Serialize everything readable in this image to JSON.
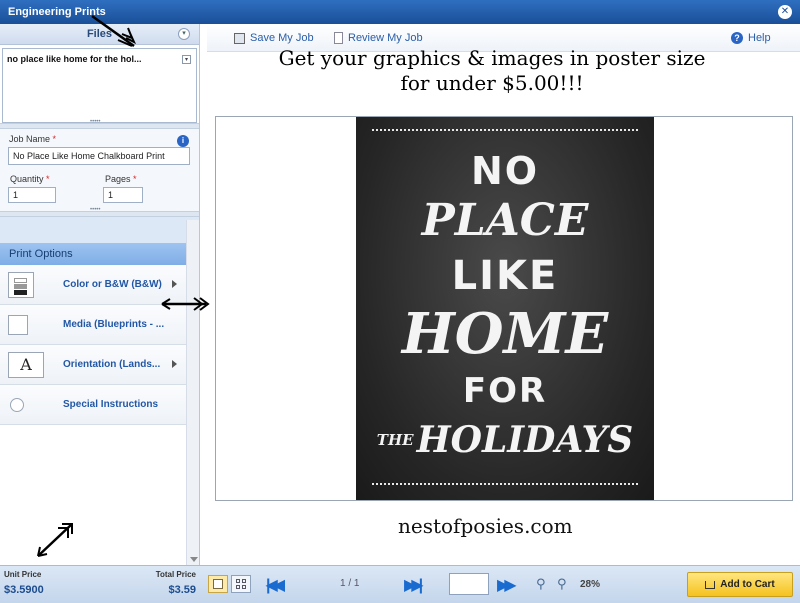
{
  "window": {
    "title": "Engineering Prints",
    "close_glyph": "✕"
  },
  "files": {
    "header": "Files",
    "selected_file": "no place like home for the hol...",
    "dropdown_glyph": "▾"
  },
  "job": {
    "name_label": "Job Name",
    "required_mark": "*",
    "name_value": "No Place Like Home Chalkboard Print",
    "quantity_label": "Quantity",
    "quantity_value": "1",
    "pages_label": "Pages",
    "pages_value": "1",
    "info_glyph": "i"
  },
  "print_options": {
    "header": "Print Options",
    "items": [
      {
        "label": "Color or B&W (B&W)",
        "icon": "color-swatch-icon"
      },
      {
        "label": "Media (Blueprints - ...",
        "icon": "media-icon"
      },
      {
        "label": "Orientation (Lands...",
        "icon": "orientation-icon",
        "glyph": "A"
      },
      {
        "label": "Special Instructions",
        "icon": "radio-icon"
      }
    ]
  },
  "toolbar": {
    "save_label": "Save My Job",
    "review_label": "Review My Job",
    "help_label": "Help",
    "help_glyph": "?"
  },
  "overlay_text": {
    "line1": "Get your graphics & images in poster size",
    "line2": "for under $5.00!!!"
  },
  "poster": {
    "lines": [
      "NO",
      "PLACE",
      "LIKE",
      "HOME",
      "FOR",
      "THE",
      "HOLIDAYS"
    ]
  },
  "watermark": "nestofposies.com",
  "pricing": {
    "unit_label": "Unit Price",
    "unit_value": "$3.5900",
    "total_label": "Total Price",
    "total_value": "$3.59"
  },
  "pager": {
    "info": "1 / 1",
    "zoom": "28%"
  },
  "cart": {
    "label": "Add to Cart"
  },
  "colors": {
    "titlebar": "#1a4f98",
    "accent_blue": "#2257a5",
    "cart_yellow": "#f5c21e",
    "poster_bg": "#262626"
  }
}
